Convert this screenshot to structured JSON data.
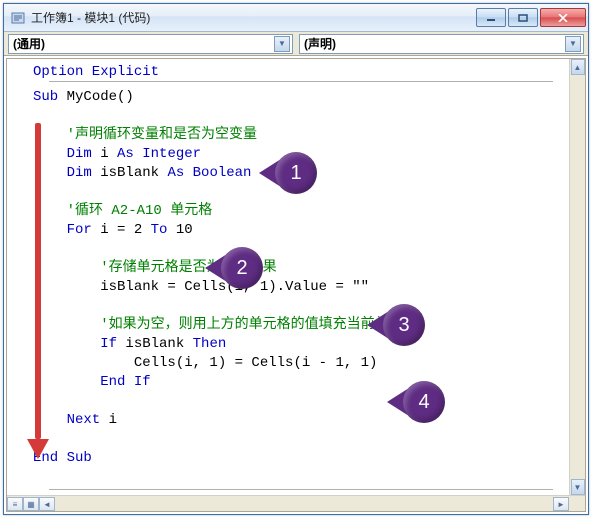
{
  "titlebar": {
    "title": "工作簿1 - 模块1 (代码)"
  },
  "dropdowns": {
    "left": "(通用)",
    "right": "(声明)"
  },
  "code": {
    "l01a": "Option Explicit",
    "l03a": "Sub ",
    "l03b": "MyCode()",
    "l05a": "    '声明循环变量和是否为空变量",
    "l06a": "    Dim ",
    "l06b": "i ",
    "l06c": "As Integer",
    "l07a": "    Dim ",
    "l07b": "isBlank ",
    "l07c": "As Boolean",
    "l09a": "    '循环 A2-A10 单元格",
    "l10a": "    For ",
    "l10b": "i = 2 ",
    "l10c": "To ",
    "l10d": "10",
    "l12a": "        '存储单元格是否为空的结果",
    "l13a": "        isBlank = Cells(i, 1).Value = \"\"",
    "l15a": "        '如果为空，则用上方的单元格的值填充当前单元格",
    "l16a": "        If ",
    "l16b": "isBlank ",
    "l16c": "Then",
    "l17a": "            Cells(i, 1) = Cells(i - 1, 1)",
    "l18a": "        End If",
    "l20a": "    Next ",
    "l20b": "i",
    "l22a": "End Sub"
  },
  "callouts": {
    "c1": "1",
    "c2": "2",
    "c3": "3",
    "c4": "4"
  },
  "colors": {
    "balloon": "#5e2c82"
  }
}
